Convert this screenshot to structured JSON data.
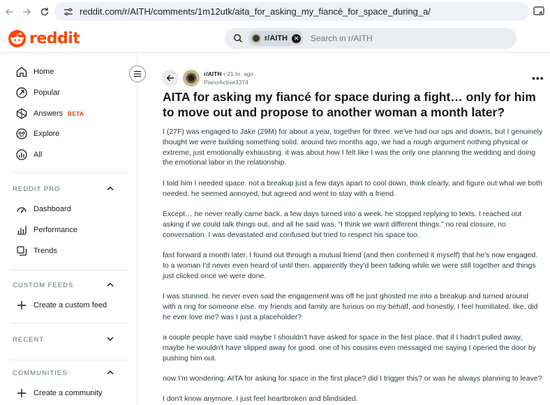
{
  "browser": {
    "url": "reddit.com/r/AITH/comments/1m12utk/aita_for_asking_my_fiancé_for_space_during_a/"
  },
  "header": {
    "logo_text": "reddit",
    "search_chip": "r/AITH",
    "search_placeholder": "Search in r/AITH"
  },
  "sidebar": {
    "nav": [
      {
        "label": "Home",
        "icon": "home-icon"
      },
      {
        "label": "Popular",
        "icon": "popular-icon"
      },
      {
        "label": "Answers",
        "icon": "answers-icon",
        "badge": "BETA"
      },
      {
        "label": "Explore",
        "icon": "explore-icon"
      },
      {
        "label": "All",
        "icon": "all-icon"
      }
    ],
    "reddit_pro": {
      "heading": "REDDIT PRO",
      "items": [
        {
          "label": "Dashboard",
          "icon": "dashboard-icon"
        },
        {
          "label": "Performance",
          "icon": "performance-icon"
        },
        {
          "label": "Trends",
          "icon": "trends-icon"
        }
      ]
    },
    "custom_feeds": {
      "heading": "CUSTOM FEEDS",
      "items": [
        {
          "label": "Create a custom feed",
          "icon": "plus-icon"
        }
      ]
    },
    "recent": {
      "heading": "RECENT"
    },
    "communities": {
      "heading": "COMMUNITIES",
      "items": [
        {
          "label": "Create a community",
          "icon": "plus-icon"
        }
      ]
    }
  },
  "post": {
    "subreddit": "r/AITH",
    "time": "21 hr. ago",
    "author": "PianoActive3374",
    "title": "AITA for asking my fiancé for space during a fight… only for him to move out and propose to another woman a month later?",
    "paragraphs": [
      "I (27F) was engaged to Jake (29M) for about a year, together for three. we've had our ups and downs, but I genuinely thought we were building something solid. around two months ago, we had a rough argument nothing physical or extreme, just emotionally exhausting. it was about how I felt like I was the only one planning the wedding and doing the emotional labor in the relationship.",
      "I told him I needed space. not a breakup just a few days apart to cool down, think clearly, and figure out what we both needed. he seemed annoyed, but agreed and went to stay with a friend.",
      "Except… he never really came back. a few days turned into a week. he stopped replying to texts. I reached out asking if we could talk things out, and all he said was, “I think we want different things.” no real closure, no conversation. I was devastated and confused but tried to respect his space too.",
      "fast forward a month later, I found out through a mutual friend (and then confirmed it myself) that he's now engaged. to a woman I'd never even heard of until then. apparently they'd been talking while we were still together and things just clicked once we were done.",
      "I was stunned. he never even said the engagement was off he just ghosted me into a breakup and turned around with a ring for someone else. my friends and family are furious on my behalf, and honestly, I feel humiliated. like, did he ever love me? was I just a placeholder?",
      "a couple people have said maybe I shouldn't have asked for space in the first place. that if I hadn't pulled away, maybe he wouldn't have slipped away for good. one of his cousins even messaged me saying I opened the door by pushing him out.",
      "now I'm wondering: AITA for asking for space in the first place? did I trigger this? or was he always planning to leave?",
      "I don't know anymore. I just feel heartbroken and blindsided."
    ]
  },
  "colors": {
    "brand": "#ff4500",
    "beta": "#d93a00",
    "text": "#1a1a1b",
    "muted": "#576f76"
  }
}
